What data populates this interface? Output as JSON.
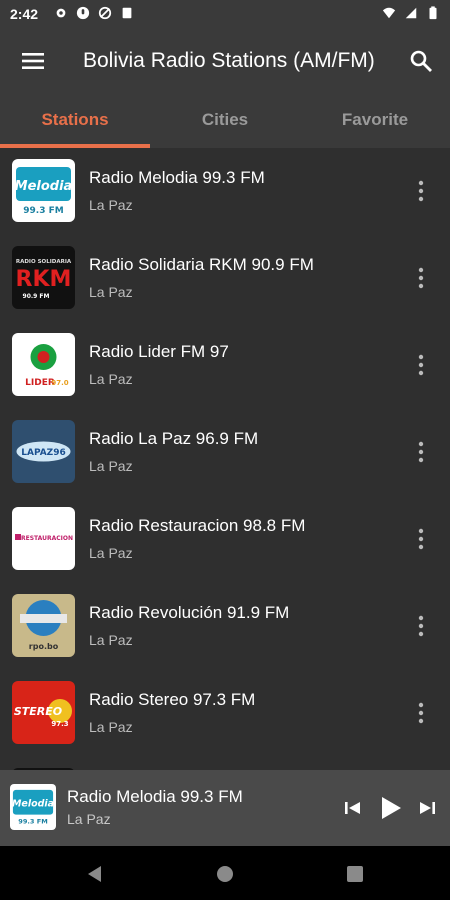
{
  "status": {
    "time": "2:42",
    "left_icons": [
      "gear-icon",
      "mic-icon",
      "data-saver-icon",
      "clipboard-icon"
    ],
    "right_icons": [
      "wifi-icon",
      "signal-icon",
      "battery-icon"
    ]
  },
  "appbar": {
    "title": "Bolivia Radio Stations (AM/FM)"
  },
  "tabs": [
    {
      "label": "Stations",
      "active": true
    },
    {
      "label": "Cities",
      "active": false
    },
    {
      "label": "Favorite",
      "active": false
    }
  ],
  "stations": [
    {
      "name": "Radio Melodia 99.3 FM",
      "city": "La Paz",
      "logo": "melodia",
      "logo_lines": [
        "Melodia",
        "99.3 FM"
      ]
    },
    {
      "name": "Radio Solidaria RKM 90.9 FM",
      "city": "La Paz",
      "logo": "rkm",
      "logo_lines": [
        "RADIO SOLIDARIA",
        "RKM",
        "90.9 FM"
      ]
    },
    {
      "name": "Radio Lider FM 97",
      "city": "La Paz",
      "logo": "lider",
      "logo_lines": [
        "LIDER",
        "97.0"
      ]
    },
    {
      "name": "Radio La Paz 96.9 FM",
      "city": "La Paz",
      "logo": "lapaz",
      "logo_lines": [
        "LAPAZ96"
      ]
    },
    {
      "name": "Radio Restauracion 98.8 FM",
      "city": "La Paz",
      "logo": "restauracion",
      "logo_lines": [
        "RESTAURACION"
      ]
    },
    {
      "name": "Radio Revolución 91.9 FM",
      "city": "La Paz",
      "logo": "revolucion",
      "logo_lines": [
        "rpo.bo"
      ]
    },
    {
      "name": "Radio Stereo 97.3 FM",
      "city": "La Paz",
      "logo": "stereo",
      "logo_lines": [
        "STEREO",
        "97.3"
      ]
    }
  ],
  "player": {
    "name": "Radio Melodia 99.3 FM",
    "city": "La Paz",
    "logo_lines": [
      "Melodia",
      "99.3 FM"
    ]
  },
  "colors": {
    "accent": "#e8704a",
    "bar": "#3a3a3a",
    "background": "#2f2f2f",
    "player": "#4a4a4a"
  }
}
